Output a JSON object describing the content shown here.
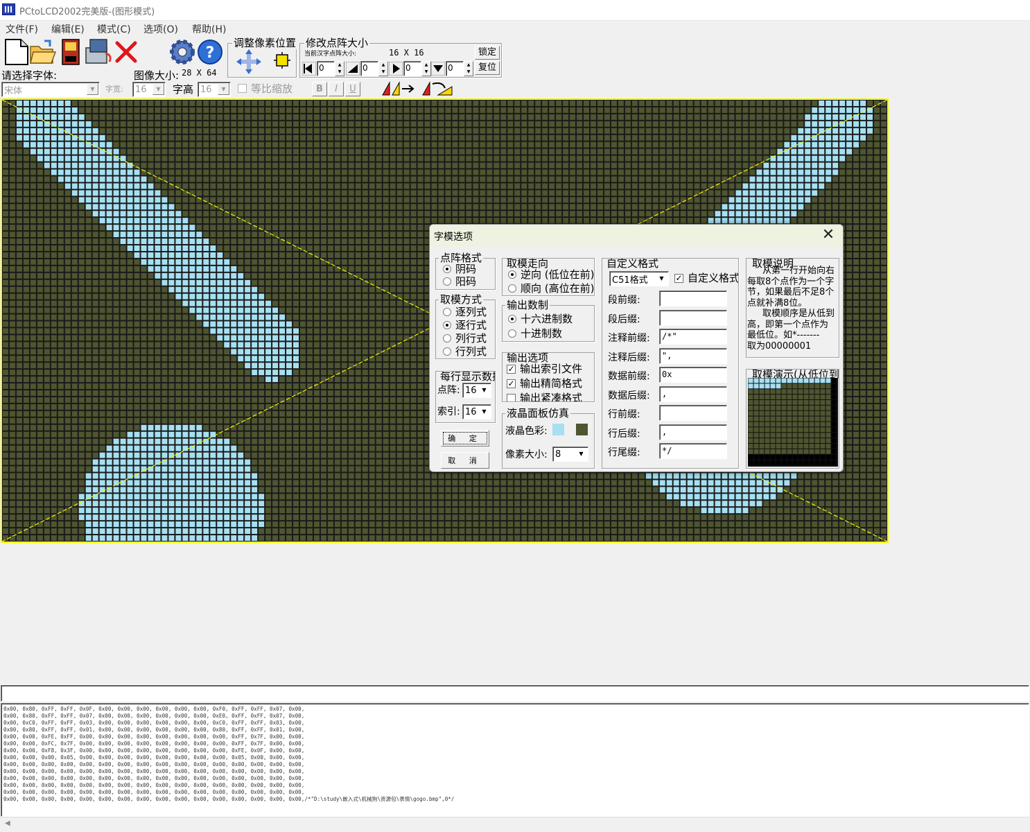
{
  "window": {
    "title": "PCtoLCD2002完美版-(图形模式)"
  },
  "menu": [
    "文件(F)",
    "编辑(E)",
    "模式(C)",
    "选项(O)",
    "帮助(H)"
  ],
  "toolbar": {
    "font_label": "请选择字体:",
    "font_value": "宋体",
    "image_size_label": "图像大小:",
    "image_size_value": "28 X 64",
    "char_width_label": "字宽:",
    "char_width_value": "16",
    "char_height_label": "字高",
    "char_height_value": "16",
    "proportional_label": "等比缩放",
    "bold": "B",
    "italic": "I",
    "underline": "U",
    "adjust_group": "调整像素位置",
    "resize_group": "修改点阵大小",
    "current_size_label": "当前汉字点阵大小:",
    "current_size_value": "16 X 16",
    "lock_button": "锁定",
    "reset_button": "复位",
    "offset_values": [
      "0",
      "0",
      "0",
      "0"
    ]
  },
  "lcd": {
    "on_color": "#a6e0f2",
    "off_color": "#4e5530",
    "guide_color": "#f5f500",
    "cols": 128,
    "rows": 64
  },
  "dialog": {
    "title": "字模选项",
    "dot_format": {
      "title": "点阵格式",
      "options": [
        "阴码",
        "阳码"
      ],
      "selected": 0
    },
    "mode": {
      "title": "取模方式",
      "options": [
        "逐列式",
        "逐行式",
        "列行式",
        "行列式"
      ],
      "selected": 1
    },
    "per_row": {
      "title": "每行显示数据",
      "dot_label": "点阵:",
      "dot_value": "16",
      "index_label": "索引:",
      "index_value": "16"
    },
    "ok_button": "确 定",
    "cancel_button": "取 消",
    "direction": {
      "title": "取模走向",
      "options": [
        "逆向 (低位在前)",
        "顺向 (高位在前)"
      ],
      "selected": 0
    },
    "radix": {
      "title": "输出数制",
      "options": [
        "十六进制数",
        "十进制数"
      ],
      "selected": 0
    },
    "output": {
      "title": "输出选项",
      "options": [
        "输出索引文件",
        "输出精简格式",
        "输出紧凑格式"
      ],
      "checked": [
        true,
        true,
        false
      ]
    },
    "lcd_sim": {
      "title": "液晶面板仿真",
      "color_label": "液晶色彩:",
      "on_color": "#a6e0f2",
      "off_color": "#4e5530",
      "pixel_label": "像素大小:",
      "pixel_value": "8"
    },
    "custom": {
      "title": "自定义格式",
      "preset": "C51格式",
      "custom_check": "自定义格式",
      "fields": [
        {
          "label": "段前缀:",
          "value": ""
        },
        {
          "label": "段后缀:",
          "value": ""
        },
        {
          "label": "注释前缀:",
          "value": "/*\""
        },
        {
          "label": "注释后缀:",
          "value": "\","
        },
        {
          "label": "数据前缀:",
          "value": "0x"
        },
        {
          "label": "数据后缀:",
          "value": ","
        },
        {
          "label": "行前缀:",
          "value": ""
        },
        {
          "label": "行后缀:",
          "value": ","
        },
        {
          "label": "行尾缀:",
          "value": "*/"
        }
      ]
    },
    "explain": {
      "title": "取模说明",
      "lines": [
        "从第一行开始向右",
        "每取8个点作为一个字",
        "节，如果最后不足8个",
        "点就补满8位。",
        "取模顺序是从低到",
        "高，即第一个点作为",
        "最低位。如*-------",
        "取为00000001"
      ]
    },
    "demo": {
      "title": "取模演示(从低位到高位)"
    }
  },
  "output_lines": [
    "0x00, 0x80, 0xFF, 0xFF, 0x0F, 0x00, 0x00, 0x00, 0x00, 0x00, 0x00, 0xF0, 0xFF, 0xFF, 0x07, 0x00,",
    "0x00, 0x80, 0xFF, 0xFF, 0x07, 0x00, 0x00, 0x00, 0x00, 0x00, 0x00, 0xE0, 0xFF, 0xFF, 0x07, 0x00,",
    "0x00, 0xC0, 0xFF, 0xFF, 0x03, 0x00, 0x00, 0x00, 0x00, 0x00, 0x00, 0xC0, 0xFF, 0xFF, 0x03, 0x00,",
    "0x00, 0x80, 0xFF, 0xFF, 0x01, 0x00, 0x00, 0x00, 0x00, 0x00, 0x00, 0x80, 0xFF, 0xFF, 0x01, 0x00,",
    "0x00, 0x00, 0xFE, 0xFF, 0x00, 0x00, 0x00, 0x00, 0x00, 0x00, 0x00, 0x00, 0xFF, 0x7F, 0x00, 0x00,",
    "0x00, 0x00, 0xFC, 0x7F, 0x00, 0x00, 0x00, 0x00, 0x00, 0x00, 0x00, 0x00, 0xFF, 0x7F, 0x00, 0x00,",
    "0x00, 0x00, 0xF8, 0x3F, 0x00, 0x00, 0x00, 0x00, 0x00, 0x00, 0x00, 0x00, 0xFE, 0x0F, 0x00, 0x00,",
    "0x00, 0x00, 0x00, 0x05, 0x00, 0x00, 0x00, 0x00, 0x00, 0x00, 0x00, 0x00, 0x05, 0x00, 0x00, 0x00,",
    "0x00, 0x00, 0x00, 0x00, 0x00, 0x00, 0x00, 0x00, 0x00, 0x00, 0x00, 0x00, 0x00, 0x00, 0x00, 0x00,",
    "0x00, 0x00, 0x00, 0x00, 0x00, 0x00, 0x00, 0x00, 0x00, 0x00, 0x00, 0x00, 0x00, 0x00, 0x00, 0x00,",
    "0x00, 0x00, 0x00, 0x00, 0x00, 0x00, 0x00, 0x00, 0x00, 0x00, 0x00, 0x00, 0x00, 0x00, 0x00, 0x00,",
    "0x00, 0x00, 0x00, 0x00, 0x00, 0x00, 0x00, 0x00, 0x00, 0x00, 0x00, 0x00, 0x00, 0x00, 0x00, 0x00,",
    "0x00, 0x00, 0x00, 0x00, 0x00, 0x00, 0x00, 0x00, 0x00, 0x00, 0x00, 0x00, 0x00, 0x00, 0x00, 0x00,",
    "0x00, 0x00, 0x00, 0x00, 0x00, 0x00, 0x00, 0x00, 0x00, 0x00, 0x00, 0x00, 0x00, 0x00, 0x00, 0x00,/*\"D:\\study\\嵌入式\\机械狗\\资源包\\表情\\gogo.bmp\",0*/"
  ]
}
